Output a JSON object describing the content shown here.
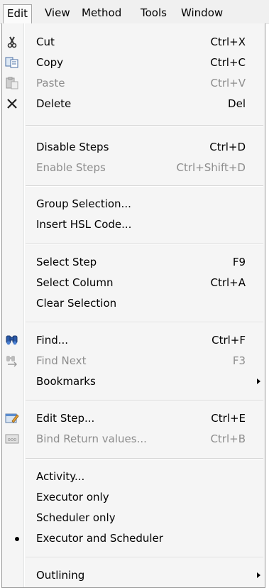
{
  "menubar": {
    "items": [
      {
        "label": "Edit"
      },
      {
        "label": "View"
      },
      {
        "label": "Method"
      },
      {
        "label": "Tools"
      },
      {
        "label": "Window"
      }
    ]
  },
  "menu": {
    "items": [
      {
        "label": "Cut",
        "shortcut": "Ctrl+X",
        "icon": "scissors-icon"
      },
      {
        "label": "Copy",
        "shortcut": "Ctrl+C",
        "icon": "copy-icon"
      },
      {
        "label": "Paste",
        "shortcut": "Ctrl+V",
        "icon": "paste-icon",
        "disabled": true
      },
      {
        "label": "Delete",
        "shortcut": "Del",
        "icon": "delete-x-icon"
      },
      {
        "label": "Disable Steps",
        "shortcut": "Ctrl+D"
      },
      {
        "label": "Enable Steps",
        "shortcut": "Ctrl+Shift+D",
        "disabled": true
      },
      {
        "label": "Group Selection..."
      },
      {
        "label": "Insert HSL Code..."
      },
      {
        "label": "Select Step",
        "shortcut": "F9"
      },
      {
        "label": "Select Column",
        "shortcut": "Ctrl+A"
      },
      {
        "label": "Clear Selection"
      },
      {
        "label": "Find...",
        "shortcut": "Ctrl+F",
        "icon": "binoculars-icon"
      },
      {
        "label": "Find Next",
        "shortcut": "F3",
        "icon": "find-next-icon",
        "disabled": true
      },
      {
        "label": "Bookmarks",
        "submenu": true
      },
      {
        "label": "Edit Step...",
        "shortcut": "Ctrl+E",
        "icon": "edit-step-icon"
      },
      {
        "label": "Bind Return values...",
        "shortcut": "Ctrl+B",
        "icon": "bind-icon",
        "disabled": true
      },
      {
        "label": "Activity..."
      },
      {
        "label": "Executor only"
      },
      {
        "label": "Scheduler only"
      },
      {
        "label": "Executor and Scheduler",
        "selected": true
      },
      {
        "label": "Outlining",
        "submenu": true
      }
    ]
  },
  "colors": {
    "menubar_bg": "#f0f0f0",
    "menu_bg": "#f5f5f5",
    "disabled_text": "#8d8d8d"
  }
}
